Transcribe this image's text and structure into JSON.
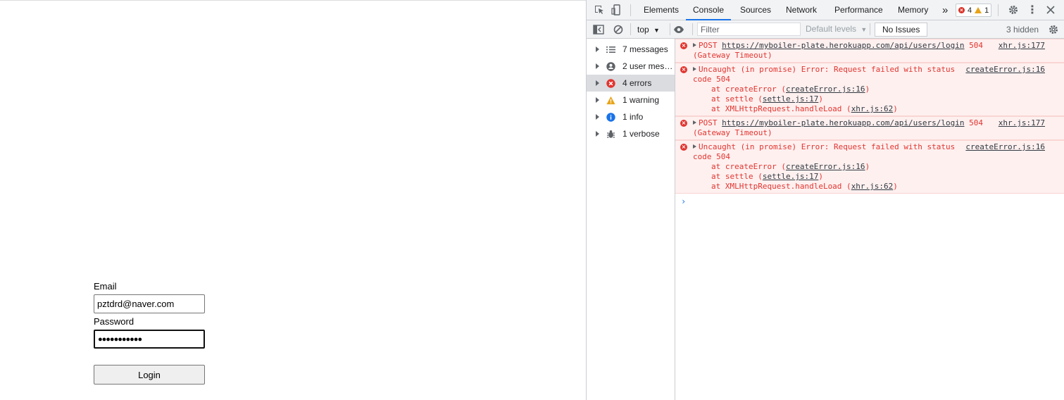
{
  "page": {
    "email_label": "Email",
    "email_value": "pztdrd@naver.com",
    "password_label": "Password",
    "password_value": "●●●●●●●●●●●",
    "login_label": "Login"
  },
  "devtools": {
    "tabs": [
      {
        "label": "Elements",
        "active": false
      },
      {
        "label": "Console",
        "active": true
      },
      {
        "label": "Sources",
        "active": false
      },
      {
        "label": "Network",
        "active": false
      },
      {
        "label": "Performance",
        "active": false
      },
      {
        "label": "Memory",
        "active": false
      }
    ],
    "more_tabs": "»",
    "error_count": "4",
    "warning_count": "1",
    "toolbar": {
      "context": "top",
      "filter_placeholder": "Filter",
      "levels": "Default levels",
      "issues": "No Issues",
      "hidden": "3 hidden"
    },
    "sidebar": [
      {
        "label": "7 messages",
        "icon": "list-icon"
      },
      {
        "label": "2 user mess...",
        "icon": "user-icon"
      },
      {
        "label": "4 errors",
        "icon": "error-icon",
        "selected": true
      },
      {
        "label": "1 warning",
        "icon": "warning-icon"
      },
      {
        "label": "1 info",
        "icon": "info-icon"
      },
      {
        "label": "1 verbose",
        "icon": "bug-icon"
      }
    ],
    "messages": [
      {
        "prefix": "POST",
        "url": "https://myboiler-plate.herokuapp.com/api/users/login",
        "status": "504",
        "detail": "(Gateway Timeout)",
        "source": "xhr.js:177"
      },
      {
        "text1": "Uncaught (in promise) Error: Request failed with status",
        "text2": "code 504",
        "source": "createError.js:16",
        "stack": [
          {
            "pre": "at createError (",
            "link": "createError.js:16",
            "post": ")"
          },
          {
            "pre": "at settle (",
            "link": "settle.js:17",
            "post": ")"
          },
          {
            "pre": "at XMLHttpRequest.handleLoad (",
            "link": "xhr.js:62",
            "post": ")"
          }
        ]
      },
      {
        "prefix": "POST",
        "url": "https://myboiler-plate.herokuapp.com/api/users/login",
        "status": "504",
        "detail": "(Gateway Timeout)",
        "source": "xhr.js:177"
      },
      {
        "text1": "Uncaught (in promise) Error: Request failed with status",
        "text2": "code 504",
        "source": "createError.js:16",
        "stack": [
          {
            "pre": "at createError (",
            "link": "createError.js:16",
            "post": ")"
          },
          {
            "pre": "at settle (",
            "link": "settle.js:17",
            "post": ")"
          },
          {
            "pre": "at XMLHttpRequest.handleLoad (",
            "link": "xhr.js:62",
            "post": ")"
          }
        ]
      }
    ],
    "prompt": "›"
  }
}
